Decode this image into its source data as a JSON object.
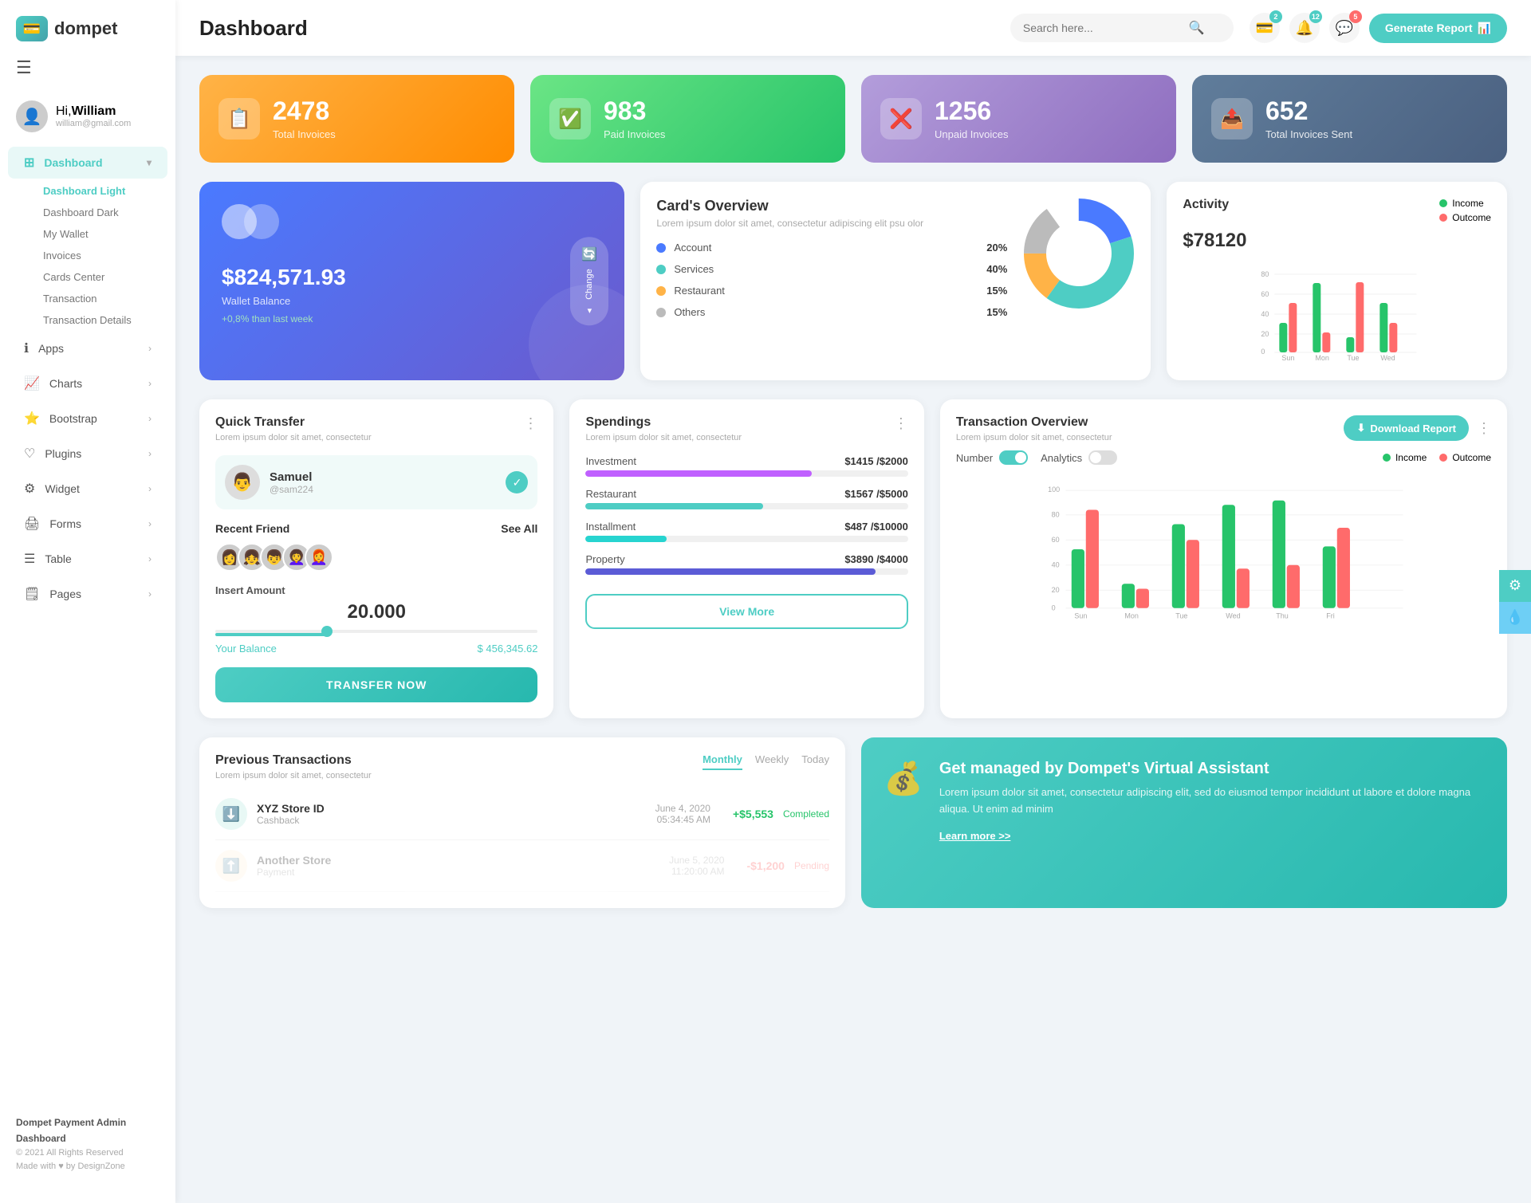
{
  "app": {
    "logo_text": "dompet",
    "header_title": "Dashboard",
    "search_placeholder": "Search here...",
    "generate_report_label": "Generate Report"
  },
  "header": {
    "notification_count1": "2",
    "notification_count2": "12",
    "notification_count3": "5"
  },
  "user": {
    "greeting": "Hi,",
    "name": "William",
    "email": "william@gmail.com"
  },
  "sidebar": {
    "nav_items": [
      {
        "label": "Dashboard",
        "icon": "⊞",
        "active": true,
        "has_arrow": true
      },
      {
        "label": "Apps",
        "icon": "ℹ️",
        "has_arrow": true
      },
      {
        "label": "Charts",
        "icon": "📈",
        "has_arrow": true
      },
      {
        "label": "Bootstrap",
        "icon": "⭐",
        "has_arrow": true
      },
      {
        "label": "Plugins",
        "icon": "♡",
        "has_arrow": true
      },
      {
        "label": "Widget",
        "icon": "⚙️",
        "has_arrow": true
      },
      {
        "label": "Forms",
        "icon": "📋",
        "has_arrow": true
      },
      {
        "label": "Table",
        "icon": "☰",
        "has_arrow": true
      },
      {
        "label": "Pages",
        "icon": "🗒️",
        "has_arrow": true
      }
    ],
    "sub_nav": [
      {
        "label": "Dashboard Light",
        "active": true
      },
      {
        "label": "Dashboard Dark",
        "active": false
      },
      {
        "label": "My Wallet",
        "active": false
      },
      {
        "label": "Invoices",
        "active": false
      },
      {
        "label": "Cards Center",
        "active": false
      },
      {
        "label": "Transaction",
        "active": false
      },
      {
        "label": "Transaction Details",
        "active": false
      }
    ],
    "footer_title": "Dompet Payment Admin Dashboard",
    "footer_copy": "© 2021 All Rights Reserved",
    "footer_made": "Made with ♥ by DesignZone"
  },
  "stats": [
    {
      "value": "2478",
      "label": "Total Invoices",
      "color": "orange",
      "icon": "📋"
    },
    {
      "value": "983",
      "label": "Paid Invoices",
      "color": "green",
      "icon": "✅"
    },
    {
      "value": "1256",
      "label": "Unpaid Invoices",
      "color": "purple",
      "icon": "❌"
    },
    {
      "value": "652",
      "label": "Total Invoices Sent",
      "color": "blue-dark",
      "icon": "📤"
    }
  ],
  "wallet": {
    "circles": true,
    "balance": "$824,571.93",
    "label": "Wallet Balance",
    "growth": "+0,8% than last week",
    "change_btn": "Change"
  },
  "cards_overview": {
    "title": "Card's Overview",
    "desc": "Lorem ipsum dolor sit amet, consectetur adipiscing elit psu olor",
    "items": [
      {
        "label": "Account",
        "pct": "20%",
        "color": "#4a7aff"
      },
      {
        "label": "Services",
        "pct": "40%",
        "color": "#4ecdc4"
      },
      {
        "label": "Restaurant",
        "pct": "15%",
        "color": "#ffb347"
      },
      {
        "label": "Others",
        "pct": "15%",
        "color": "#bbb"
      }
    ]
  },
  "activity": {
    "title": "Activity",
    "amount": "$78120",
    "legend": [
      {
        "label": "Income",
        "color": "#27c46a"
      },
      {
        "label": "Outcome",
        "color": "#ff6b6b"
      }
    ],
    "bars": {
      "labels": [
        "Sun",
        "Mon",
        "Tue",
        "Wed"
      ],
      "income": [
        30,
        65,
        15,
        50
      ],
      "outcome": [
        50,
        20,
        70,
        30
      ]
    }
  },
  "quick_transfer": {
    "title": "Quick Transfer",
    "desc": "Lorem ipsum dolor sit amet, consectetur",
    "person": {
      "name": "Samuel",
      "id": "@sam224",
      "avatar": "👨"
    },
    "recent_label": "Recent Friend",
    "see_all": "See All",
    "friends": [
      "👩",
      "👧",
      "👦",
      "👩‍🦱",
      "👩‍🦰"
    ],
    "insert_amount_label": "Insert Amount",
    "amount": "20.000",
    "balance_label": "Your Balance",
    "balance_value": "$ 456,345.62",
    "transfer_btn": "TRANSFER NOW"
  },
  "spendings": {
    "title": "Spendings",
    "desc": "Lorem ipsum dolor sit amet, consectetur",
    "items": [
      {
        "label": "Investment",
        "amount": "$1415",
        "total": "$2000",
        "pct": 70,
        "color": "#c060ff"
      },
      {
        "label": "Restaurant",
        "amount": "$1567",
        "total": "$5000",
        "pct": 55,
        "color": "#4ecdc4"
      },
      {
        "label": "Installment",
        "amount": "$487",
        "total": "$10000",
        "pct": 25,
        "color": "#27d4d0"
      },
      {
        "label": "Property",
        "amount": "$3890",
        "total": "$4000",
        "pct": 90,
        "color": "#5b5bd6"
      }
    ],
    "view_more_btn": "View More"
  },
  "transaction_overview": {
    "title": "Transaction Overview",
    "desc": "Lorem ipsum dolor sit amet, consectetur",
    "download_label": "Download Report",
    "toggle_number": "Number",
    "toggle_analytics": "Analytics",
    "legend": [
      {
        "label": "Income",
        "color": "#27c46a"
      },
      {
        "label": "Outcome",
        "color": "#ff6b6b"
      }
    ],
    "bars": {
      "labels": [
        "Sun",
        "Mon",
        "Tue",
        "Wed",
        "Thu",
        "Fri"
      ],
      "income": [
        45,
        20,
        68,
        85,
        88,
        50
      ],
      "outcome": [
        80,
        15,
        55,
        32,
        35,
        65
      ]
    }
  },
  "previous_transactions": {
    "title": "Previous Transactions",
    "desc": "Lorem ipsum dolor sit amet, consectetur",
    "tabs": [
      "Monthly",
      "Weekly",
      "Today"
    ],
    "active_tab": "Monthly",
    "rows": [
      {
        "name": "XYZ Store ID",
        "type": "Cashback",
        "date": "June 4, 2020",
        "time": "05:34:45 AM",
        "amount": "+$5,553",
        "status": "Completed",
        "icon": "⬇️"
      }
    ]
  },
  "virtual_assistant": {
    "title": "Get managed by Dompet's Virtual Assistant",
    "desc": "Lorem ipsum dolor sit amet, consectetur adipiscing elit, sed do eiusmod tempor incididunt ut labore et dolore magna aliqua. Ut enim ad minim",
    "link": "Learn more >>"
  }
}
